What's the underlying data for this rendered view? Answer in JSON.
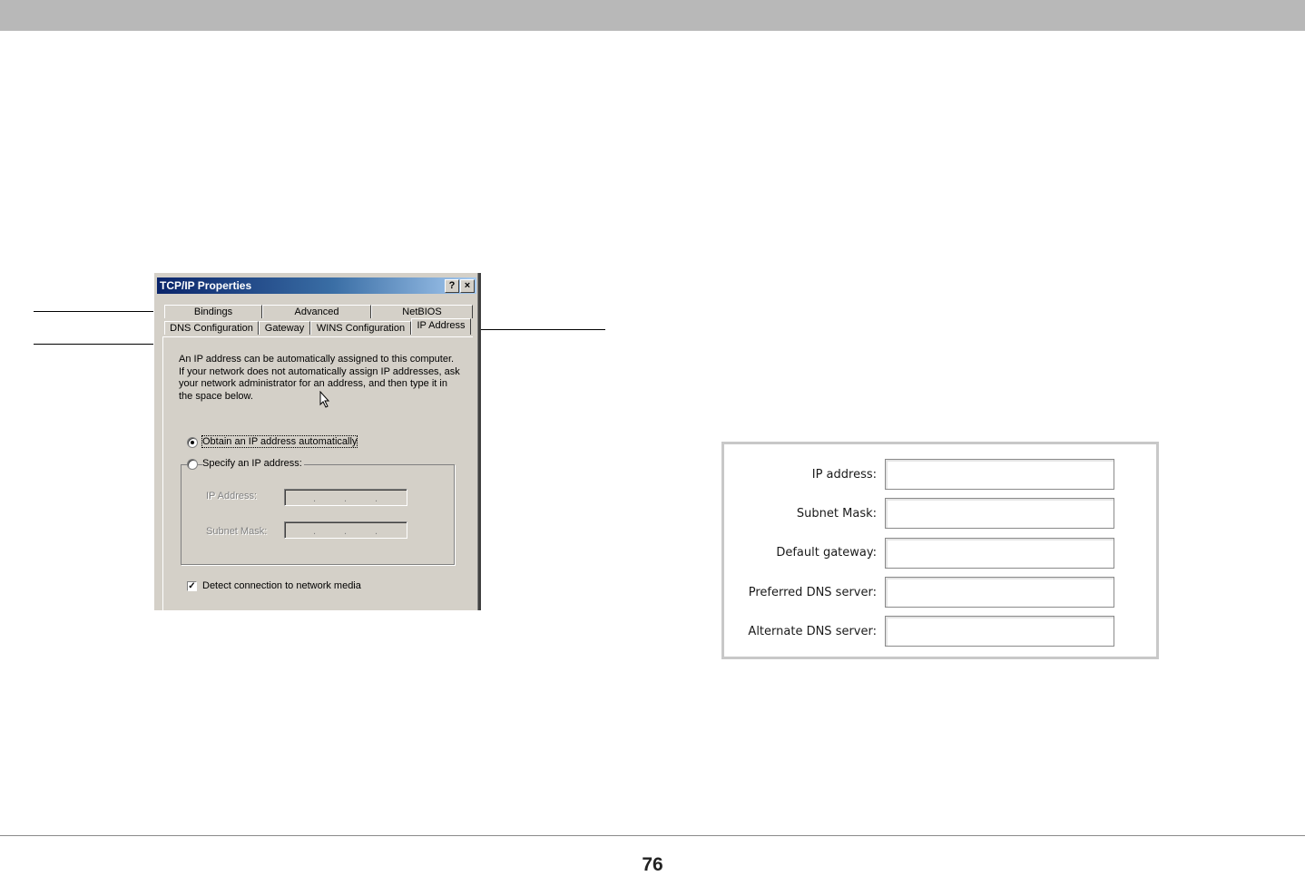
{
  "page": {
    "page_number": "76"
  },
  "dialog": {
    "title": "TCP/IP Properties",
    "help_button": "?",
    "close_button": "×",
    "tabs_back_row": [
      "Bindings",
      "Advanced",
      "NetBIOS"
    ],
    "tabs_front_row": [
      "DNS Configuration",
      "Gateway",
      "WINS Configuration",
      "IP Address"
    ],
    "active_tab": "IP Address",
    "description": "An IP address can be automatically assigned to this computer. If your network does not automatically assign IP addresses, ask your network administrator for an address, and then type it in the space below.",
    "option_auto": "Obtain an IP address automatically",
    "option_specify": "Specify an IP address:",
    "selected_option": "Obtain an IP address automatically",
    "ip_address_label": "IP Address:",
    "subnet_mask_label": "Subnet Mask:",
    "detect_label": "Detect connection to network media",
    "detect_checked": true
  },
  "form": {
    "fields": [
      {
        "label": "IP address:",
        "value": ""
      },
      {
        "label": "Subnet Mask:",
        "value": ""
      },
      {
        "label": "Default gateway:",
        "value": ""
      },
      {
        "label": "Preferred DNS server:",
        "value": ""
      },
      {
        "label": "Alternate DNS server:",
        "value": ""
      }
    ]
  }
}
